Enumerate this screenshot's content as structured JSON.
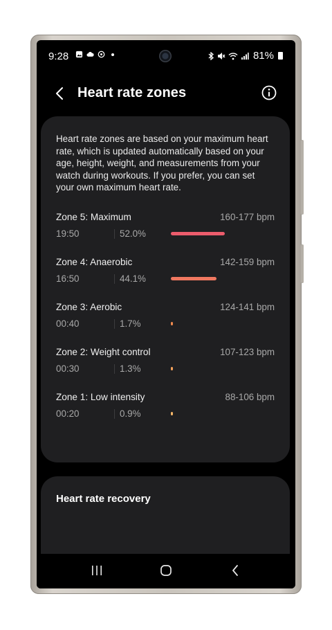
{
  "status_bar": {
    "time": "9:28",
    "battery": "81%"
  },
  "header": {
    "title": "Heart rate zones"
  },
  "intro": "Heart rate zones are based on your maximum heart rate, which is updated automatically based on your age, height, weight, and measurements from your watch during workouts. If you prefer, you can set your own maximum heart rate.",
  "zones": [
    {
      "name": "Zone 5: Maximum",
      "range": "160-177 bpm",
      "time": "19:50",
      "percent": "52.0%",
      "share": 0.52,
      "color": "#ec5c6c"
    },
    {
      "name": "Zone 4: Anaerobic",
      "range": "142-159 bpm",
      "time": "16:50",
      "percent": "44.1%",
      "share": 0.441,
      "color": "#f07860"
    },
    {
      "name": "Zone 3: Aerobic",
      "range": "124-141 bpm",
      "time": "00:40",
      "percent": "1.7%",
      "share": 0.017,
      "color": "#f08a4e"
    },
    {
      "name": "Zone 2: Weight control",
      "range": "107-123 bpm",
      "time": "00:30",
      "percent": "1.3%",
      "share": 0.013,
      "color": "#f4a15a"
    },
    {
      "name": "Zone 1: Low intensity",
      "range": "88-106 bpm",
      "time": "00:20",
      "percent": "0.9%",
      "share": 0.009,
      "color": "#f6b768"
    }
  ],
  "recovery": {
    "title": "Heart rate recovery"
  }
}
